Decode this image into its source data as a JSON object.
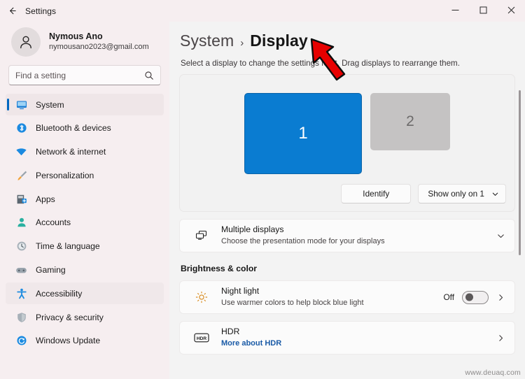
{
  "window": {
    "title": "Settings",
    "back_icon": "back-arrow-icon",
    "minimize_label": "–",
    "maximize_label": "□",
    "close_label": "✕"
  },
  "account": {
    "name": "Nymous Ano",
    "email": "nymousano2023@gmail.com",
    "avatar_icon": "person-icon"
  },
  "search": {
    "placeholder": "Find a setting",
    "value": "",
    "icon": "search-icon"
  },
  "sidebar": {
    "items": [
      {
        "label": "System",
        "icon": "monitor-icon",
        "state": "selected"
      },
      {
        "label": "Bluetooth & devices",
        "icon": "bluetooth-icon",
        "state": "normal"
      },
      {
        "label": "Network & internet",
        "icon": "wifi-icon",
        "state": "normal"
      },
      {
        "label": "Personalization",
        "icon": "paintbrush-icon",
        "state": "normal"
      },
      {
        "label": "Apps",
        "icon": "apps-grid-icon",
        "state": "normal"
      },
      {
        "label": "Accounts",
        "icon": "account-person-icon",
        "state": "normal"
      },
      {
        "label": "Time & language",
        "icon": "clock-icon",
        "state": "normal"
      },
      {
        "label": "Gaming",
        "icon": "gamepad-icon",
        "state": "normal"
      },
      {
        "label": "Accessibility",
        "icon": "accessibility-icon",
        "state": "hover"
      },
      {
        "label": "Privacy & security",
        "icon": "shield-icon",
        "state": "normal"
      },
      {
        "label": "Windows Update",
        "icon": "update-refresh-icon",
        "state": "normal"
      }
    ]
  },
  "main": {
    "breadcrumb_root": "System",
    "breadcrumb_separator": "›",
    "breadcrumb_leaf": "Display",
    "subtitle": "Select a display to change the settings for it. Drag displays to rearrange them.",
    "displays": [
      {
        "number": "1",
        "selected": true
      },
      {
        "number": "2",
        "selected": false
      }
    ],
    "identify_button": "Identify",
    "projection_mode": "Show only on 1",
    "projection_chevron": "chevron-down-icon",
    "rows": [
      {
        "title": "Multiple displays",
        "subtitle": "Choose the presentation mode for your displays",
        "icon": "multiple-displays-icon",
        "expand_icon": "chevron-down-icon"
      }
    ],
    "section_brightness": "Brightness & color",
    "night_light": {
      "title": "Night light",
      "subtitle": "Use warmer colors to help block blue light",
      "icon": "brightness-sun-icon",
      "state": "Off",
      "toggle_on": false,
      "chevron": "chevron-right-icon"
    },
    "hdr": {
      "title": "HDR",
      "subtitle": "More about HDR",
      "icon": "hdr-badge-icon",
      "chevron": "chevron-right-icon"
    }
  },
  "overlay": {
    "cursor_icon": "red-arrow-cursor",
    "watermark": "www.deuaq.com"
  },
  "colors": {
    "accent": "#0067c0",
    "display_selected": "#0a7cd1",
    "display_unselected": "#c5c3c3",
    "sidebar_bg": "#f6eef0",
    "link": "#195aa6",
    "cursor_red": "#e70000"
  }
}
